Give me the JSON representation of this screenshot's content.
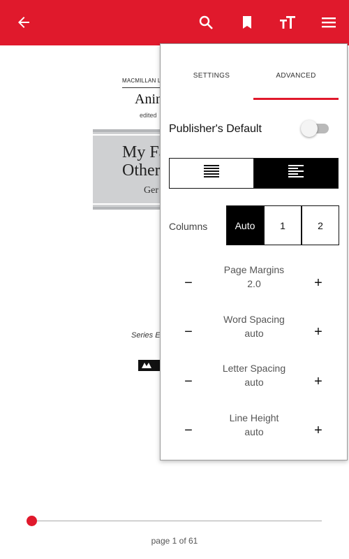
{
  "toolbar": {
    "icons": [
      "back-arrow-icon",
      "search-icon",
      "bookmark-icon",
      "text-size-icon",
      "menu-icon"
    ],
    "color": "#e0192c"
  },
  "book_page": {
    "series_header": "MACMILLAN L",
    "title_fragment": "Anin",
    "edited_fragment": "edited",
    "cover_line1": "My Fa",
    "cover_line2": "Other",
    "cover_line3": "Ger",
    "series_editor": "Series E",
    "publisher_logo": "M"
  },
  "settings_panel": {
    "tabs": [
      {
        "label": "SETTINGS",
        "active": false
      },
      {
        "label": "ADVANCED",
        "active": true
      }
    ],
    "publishers_default": {
      "label": "Publisher's Default",
      "enabled": false
    },
    "alignment": {
      "options": [
        "justify",
        "left"
      ],
      "selected": "left"
    },
    "columns": {
      "label": "Columns",
      "options": [
        "Auto",
        "1",
        "2"
      ],
      "selected": "Auto"
    },
    "steppers": [
      {
        "title": "Page Margins",
        "value": "2.0"
      },
      {
        "title": "Word Spacing",
        "value": "auto"
      },
      {
        "title": "Letter Spacing",
        "value": "auto"
      },
      {
        "title": "Line Height",
        "value": "auto"
      }
    ],
    "minus_symbol": "−",
    "plus_symbol": "+"
  },
  "progress": {
    "page_label": "page 1 of 61",
    "current_page": 1,
    "total_pages": 61
  }
}
